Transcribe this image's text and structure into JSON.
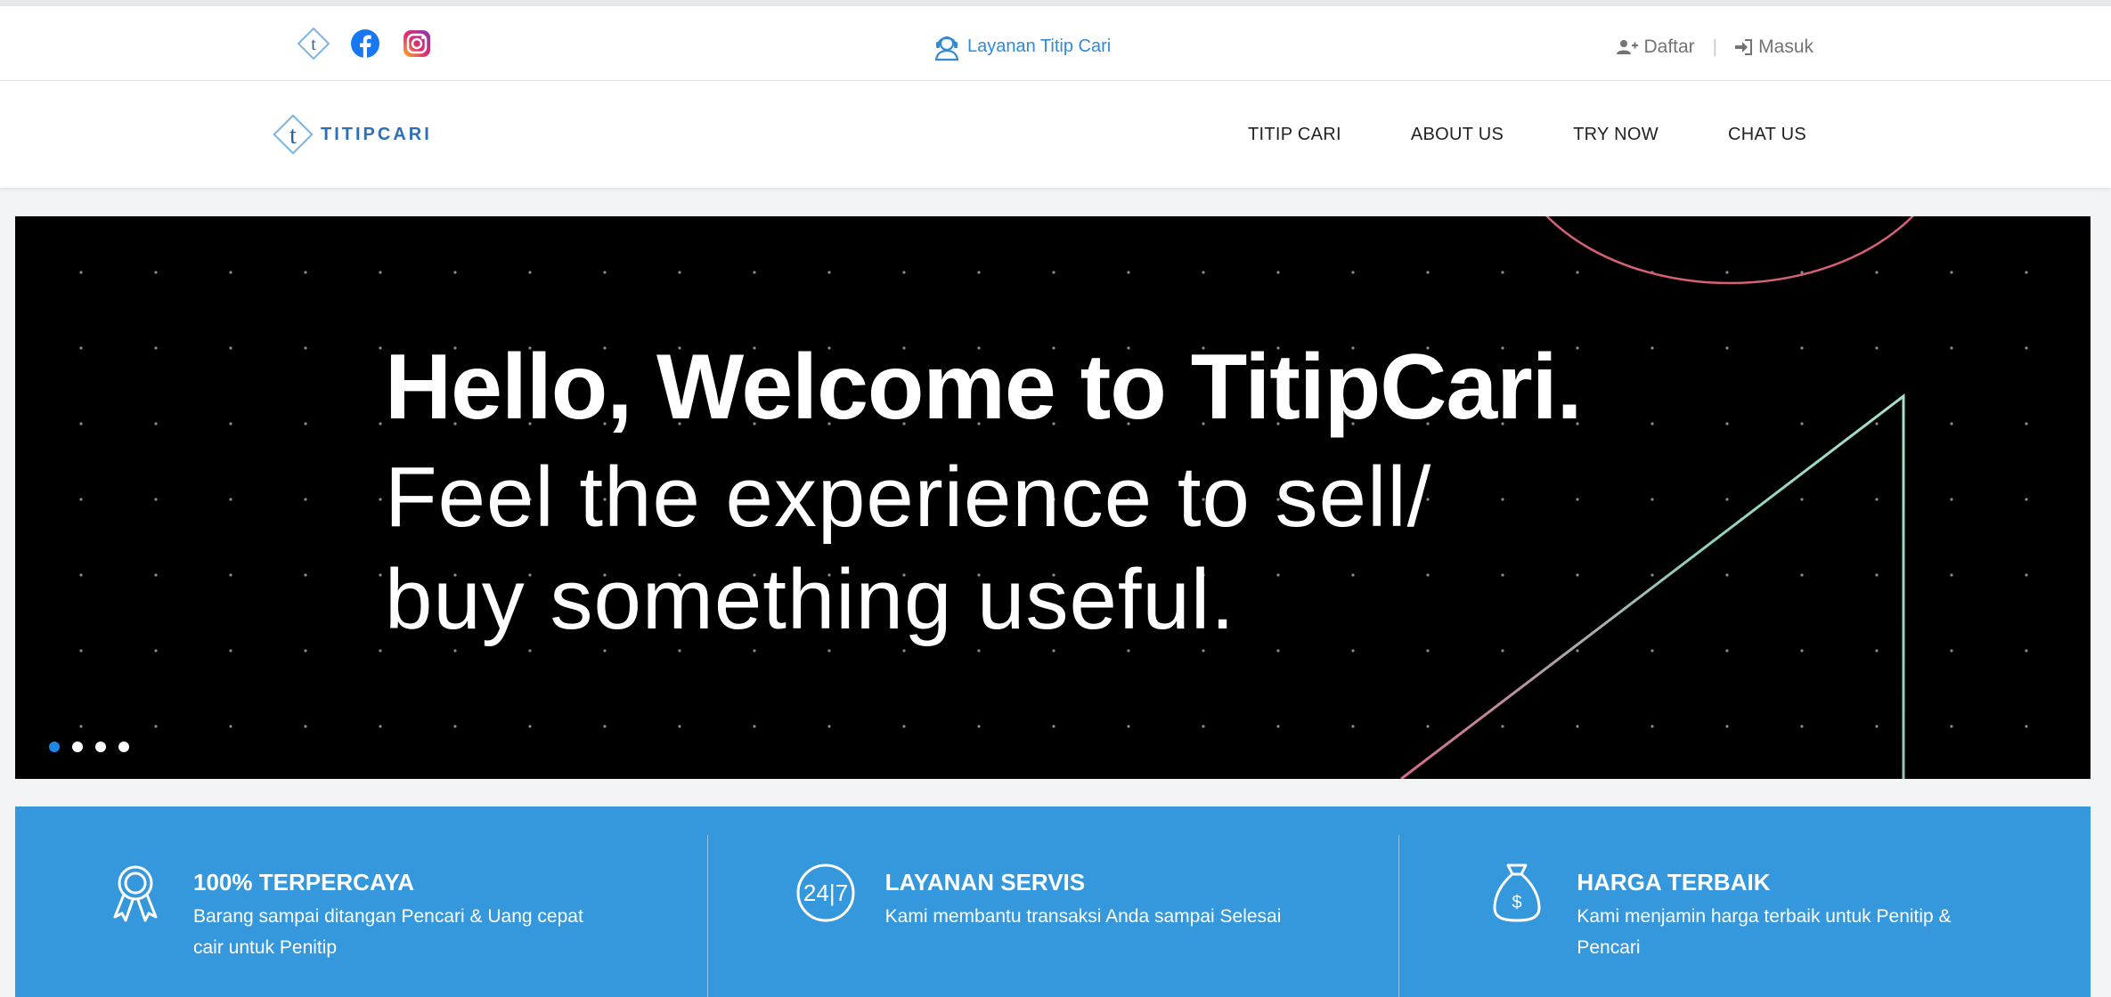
{
  "topbar": {
    "social": [
      {
        "name": "titipcari-logo-icon",
        "label": "TitipCari"
      },
      {
        "name": "facebook-icon",
        "label": "Facebook"
      },
      {
        "name": "instagram-icon",
        "label": "Instagram"
      }
    ],
    "service_link": "Layanan Titip Cari",
    "register": "Daftar",
    "separator": "|",
    "login": "Masuk"
  },
  "navbar": {
    "logo_text": "TITIPCARI",
    "menu": [
      "TITIP CARI",
      "ABOUT US",
      "TRY NOW",
      "CHAT US"
    ]
  },
  "hero": {
    "line1": "Hello, Welcome to TitipCari.",
    "line2": "Feel the experience to sell/",
    "line3": "buy something useful.",
    "slides": 4,
    "active_slide": 1
  },
  "features": [
    {
      "icon": "award-ribbon-icon",
      "title": "100% TERPERCAYA",
      "desc": "Barang sampai ditangan Pencari & Uang cepat cair untuk Penitip"
    },
    {
      "icon": "24-7-icon",
      "title": "LAYANAN SERVIS",
      "desc": "Kami membantu transaksi Anda sampai Selesai"
    },
    {
      "icon": "money-bag-icon",
      "title": "HARGA TERBAIK",
      "desc": "Kami menjamin harga terbaik untuk Penitip & Pencari"
    }
  ],
  "colors": {
    "accent": "#3598dc",
    "link": "#2f8ad8",
    "active_dot": "#1e88e5",
    "hero_bg": "#000000"
  }
}
